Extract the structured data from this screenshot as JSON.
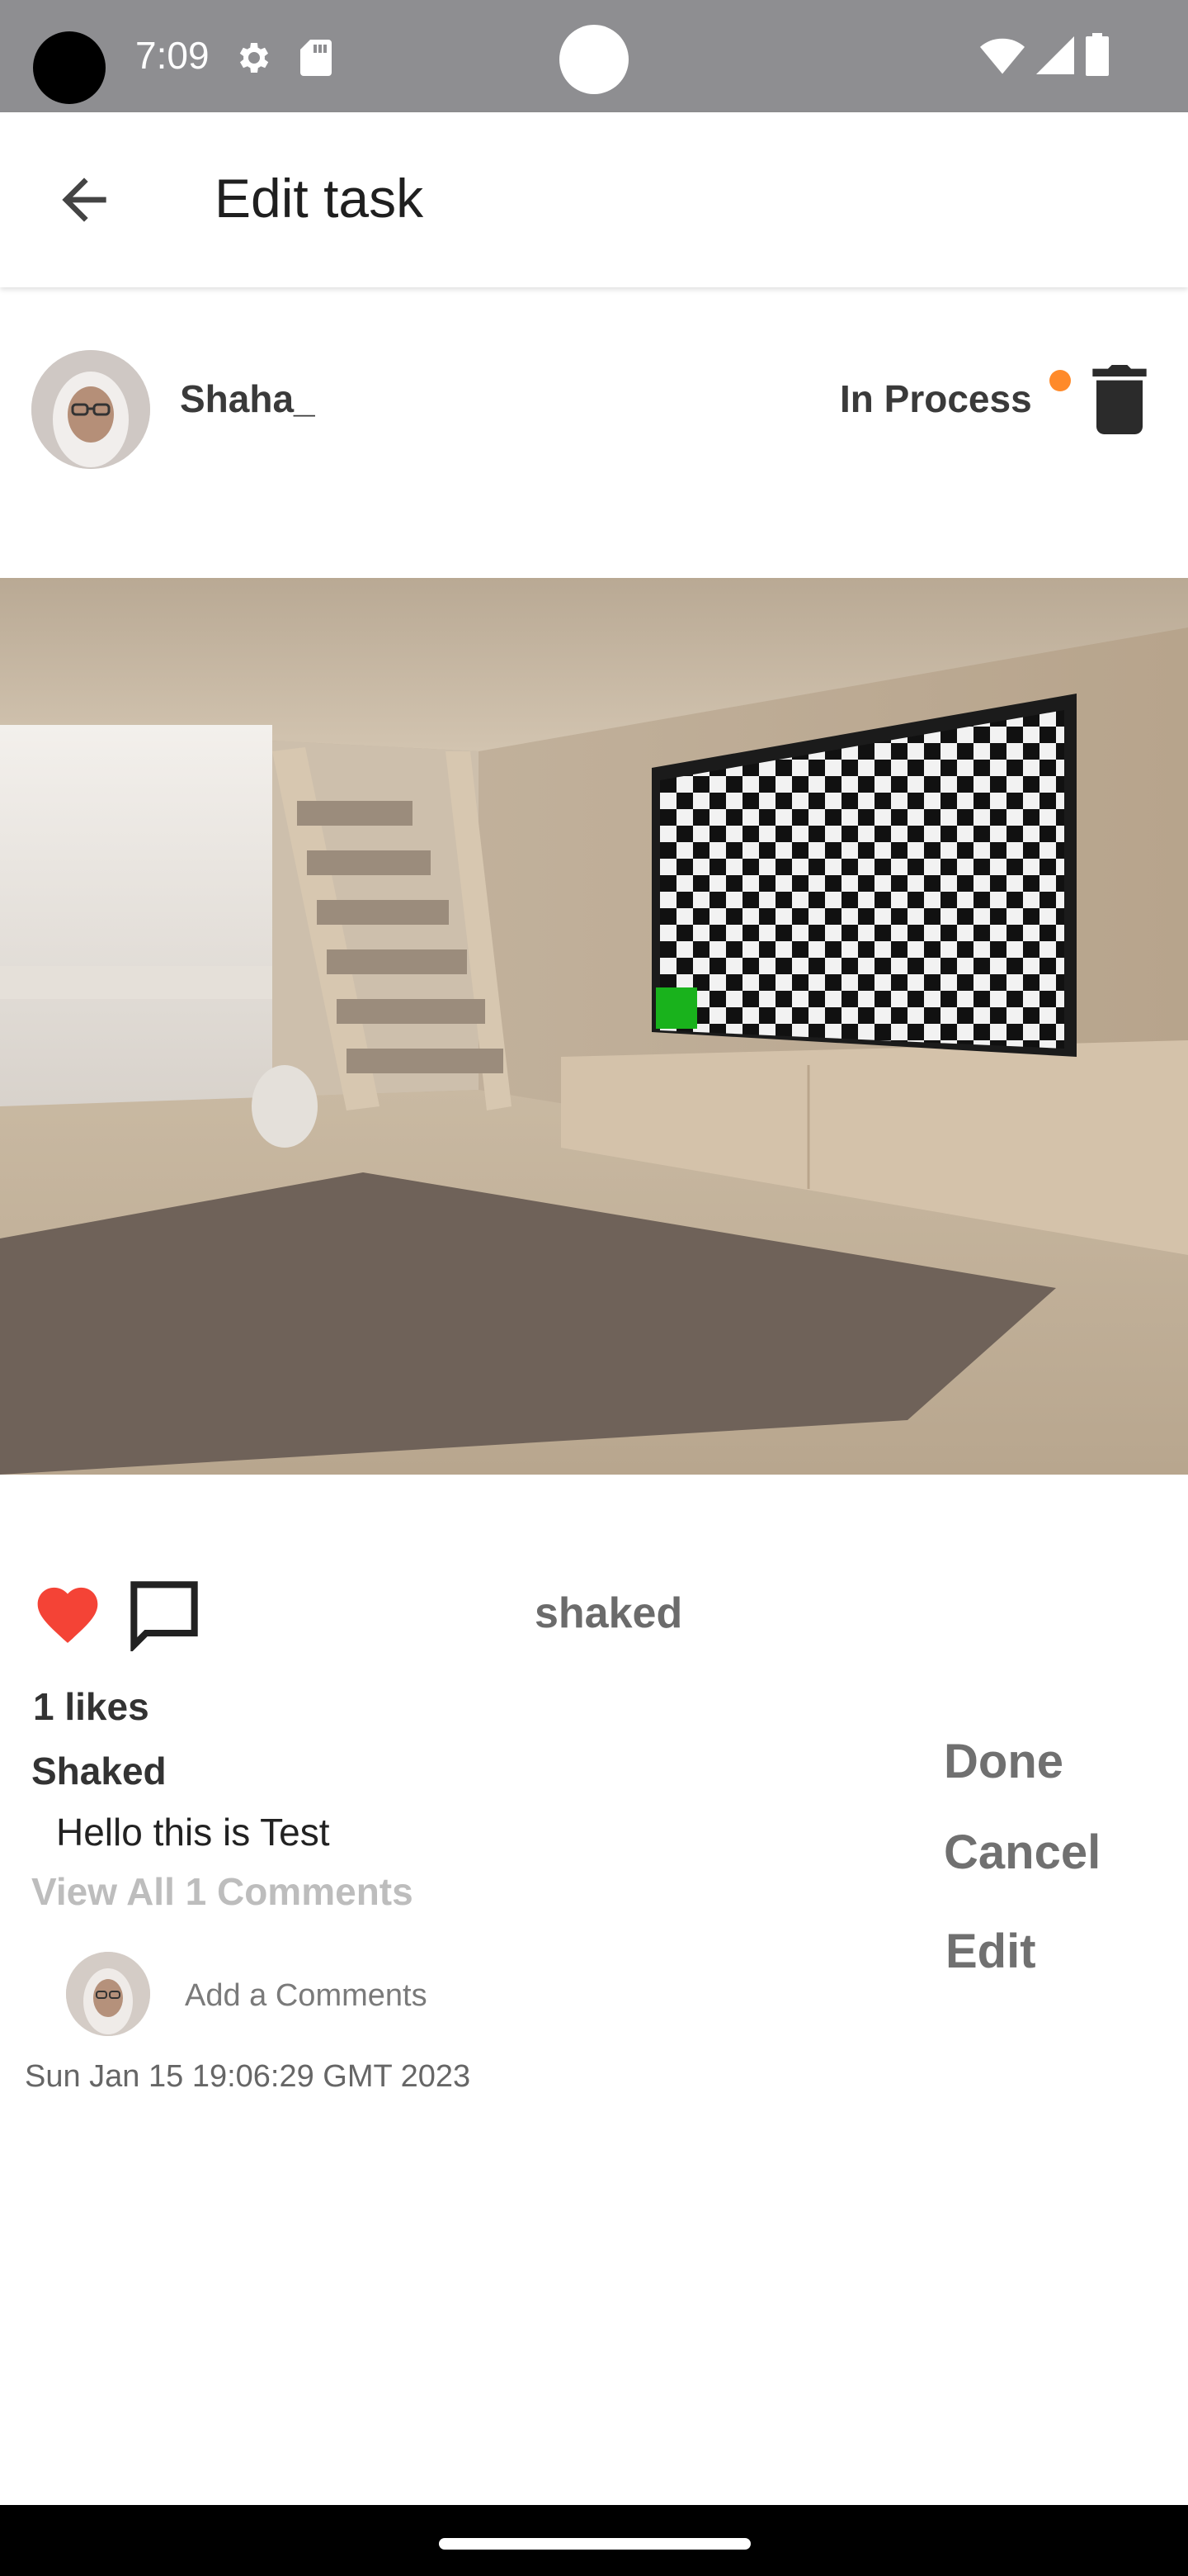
{
  "status_bar": {
    "time": "7:09",
    "icons": [
      "settings-gear-icon",
      "sd-card-icon",
      "wifi-icon",
      "cell-signal-icon",
      "battery-icon"
    ]
  },
  "toolbar": {
    "back_icon": "arrow-left-icon",
    "title": "Edit task"
  },
  "post": {
    "username": "Shaha_",
    "status": "In Process",
    "status_color": "#ff8a2a",
    "owner_label": "shaked",
    "likes": "1 likes",
    "comment": {
      "author": "Shaked",
      "text": "Hello this is Test"
    },
    "view_all": "View All 1 Comments",
    "add_comment_placeholder": "Add a Comments",
    "timestamp": "Sun Jan 15 19:06:29 GMT 2023",
    "liked": true,
    "like_color": "#f44336"
  },
  "actions": {
    "done": "Done",
    "cancel": "Cancel",
    "edit": "Edit"
  }
}
